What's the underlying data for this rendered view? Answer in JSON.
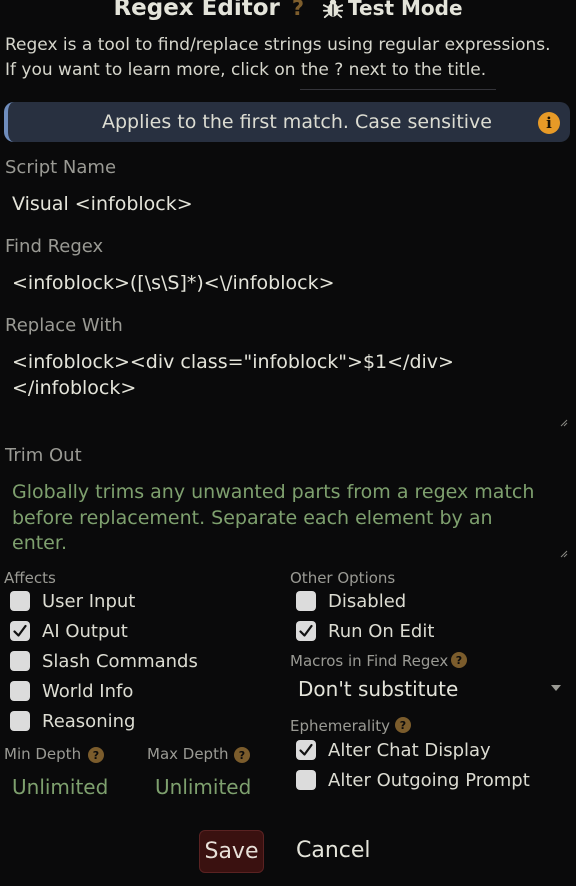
{
  "header": {
    "title": "Regex Editor",
    "help_mark": "?",
    "test_mode_label": "Test Mode"
  },
  "description": {
    "line1": "Regex is a tool to find/replace strings using regular expressions.",
    "line2": "If you want to learn more, click on the ? next to the title."
  },
  "info_bar": {
    "text": "Applies to the first match. Case sensitive",
    "icon_glyph": "i"
  },
  "script_name": {
    "label": "Script Name",
    "value": "Visual <infoblock>"
  },
  "find_regex": {
    "label": "Find Regex",
    "value": "<infoblock>([\\s\\S]*)<\\/infoblock>"
  },
  "replace_with": {
    "label": "Replace With",
    "line1": "<infoblock><div class=\"infoblock\">$1</div>",
    "line2": "</infoblock>"
  },
  "trim_out": {
    "label": "Trim Out",
    "placeholder_line1": "Globally trims any unwanted parts from a regex match",
    "placeholder_line2": "before replacement. Separate each element by an",
    "placeholder_line3": "enter."
  },
  "affects": {
    "label": "Affects",
    "items": [
      {
        "label": "User Input",
        "checked": false
      },
      {
        "label": "AI Output",
        "checked": true
      },
      {
        "label": "Slash Commands",
        "checked": false
      },
      {
        "label": "World Info",
        "checked": false
      },
      {
        "label": "Reasoning",
        "checked": false
      }
    ]
  },
  "depth": {
    "min_label": "Min Depth",
    "max_label": "Max Depth",
    "min_placeholder": "Unlimited",
    "max_placeholder": "Unlimited",
    "help_glyph": "?"
  },
  "other_options": {
    "label": "Other Options",
    "items": [
      {
        "label": "Disabled",
        "checked": false
      },
      {
        "label": "Run On Edit",
        "checked": true
      }
    ]
  },
  "macros": {
    "label": "Macros in Find Regex",
    "help_glyph": "?",
    "selected": "Don't substitute"
  },
  "ephemerality": {
    "label": "Ephemerality",
    "help_glyph": "?",
    "items": [
      {
        "label": "Alter Chat Display",
        "checked": true
      },
      {
        "label": "Alter Outgoing Prompt",
        "checked": false
      }
    ]
  },
  "buttons": {
    "save": "Save",
    "cancel": "Cancel"
  },
  "colors": {
    "background": "#0a0a0b",
    "info_bar_bg": "#283040",
    "info_icon": "#e79a27",
    "placeholder_green": "#7ea06e",
    "save_bg": "#3a1110"
  }
}
